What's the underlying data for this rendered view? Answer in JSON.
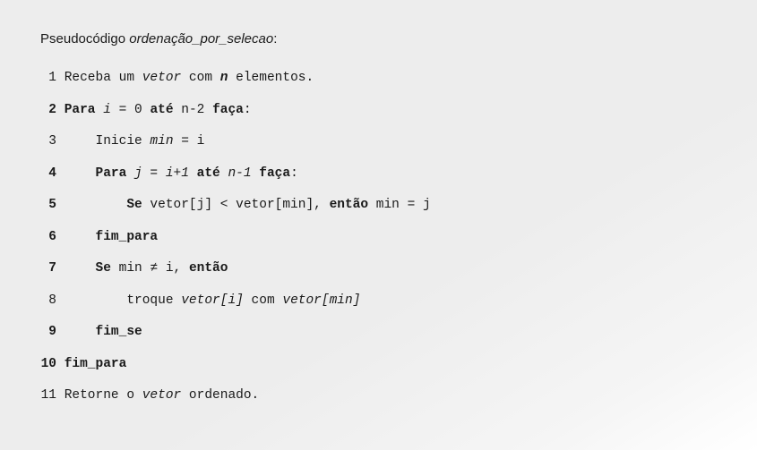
{
  "title": {
    "prefix": "Pseudocódigo ",
    "name": "ordenação_por_selecao",
    "suffix": ":"
  },
  "lines": {
    "l1": {
      "num": "1",
      "a": " Receba um ",
      "b": "vetor",
      "c": " com ",
      "d": "n",
      "e": " elementos."
    },
    "l2": {
      "num": "2",
      "a": " Para ",
      "b": "i",
      "c": " = 0 ",
      "d": "até",
      "e": " n-2 ",
      "f": "faça",
      "g": ":"
    },
    "l3": {
      "num": "3",
      "a": "     Inicie ",
      "b": "min",
      "c": " = i"
    },
    "l4": {
      "num": "4",
      "a": "     Para ",
      "b": "j",
      "c": " = ",
      "d": "i+1",
      "e": " até ",
      "f": "n-1",
      "g": " faça",
      "h": ":"
    },
    "l5": {
      "num": "5",
      "a": "         Se",
      "b": " vetor[j] < vetor[min], ",
      "c": "então",
      "d": " min = j"
    },
    "l6": {
      "num": "6",
      "a": "     fim_para"
    },
    "l7": {
      "num": "7",
      "a": "     Se",
      "b": " min ≠ i, ",
      "c": "então"
    },
    "l8": {
      "num": "8",
      "a": "         troque ",
      "b": "vetor[i]",
      "c": " com ",
      "d": "vetor[min]"
    },
    "l9": {
      "num": "9",
      "a": "     fim_se"
    },
    "l10": {
      "num": "10",
      "a": " fim_para"
    },
    "l11": {
      "num": "11",
      "a": " Retorne o ",
      "b": "vetor",
      "c": " ordenado."
    }
  }
}
